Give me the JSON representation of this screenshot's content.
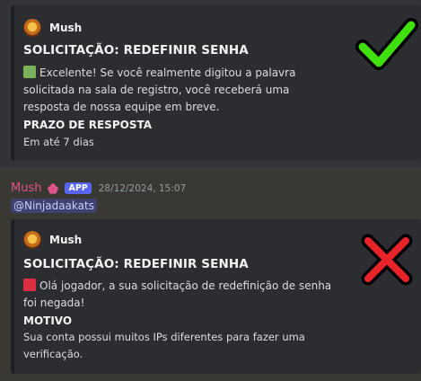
{
  "embed1": {
    "author": "Mush",
    "title": "SOLICITAÇÃO: REDEFINIR SENHA",
    "description": "Excelente! Se você realmente digitou a palavra solicitada na sala de registro, você receberá uma resposta de nossa equipe em breve.",
    "field_name": "PRAZO DE RESPOSTA",
    "field_value": "Em até 7 dias",
    "status_icon": "check-mark-icon",
    "accent_color": "#78b159"
  },
  "message": {
    "username": "Mush",
    "badge": "APP",
    "timestamp": "28/12/2024, 15:07",
    "mention": "@Ninjadaakats",
    "username_color": "#e0548c"
  },
  "embed2": {
    "author": "Mush",
    "title": "SOLICITAÇÃO: REDEFINIR SENHA",
    "description": "Olá jogador, a sua solicitação de redefinição de senha foi negada!",
    "field_name": "MOTIVO",
    "field_value": "Sua conta possui muitos IPs diferentes para fazer uma verificação.",
    "status_icon": "cross-mark-icon",
    "accent_color": "#dd2e44"
  }
}
